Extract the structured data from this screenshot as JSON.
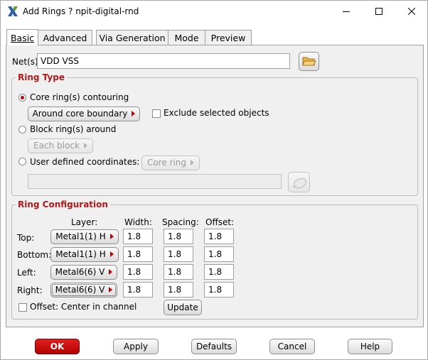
{
  "window": {
    "title": "Add Rings ? npit-digital-rnd",
    "minimize_icon": "minimize-icon",
    "maximize_icon": "maximize-icon",
    "close_icon": "close-icon"
  },
  "tabs": [
    {
      "label": "Basic",
      "active": true
    },
    {
      "label": "Advanced"
    },
    {
      "label": "Via Generation"
    },
    {
      "label": "Mode"
    },
    {
      "label": "Preview"
    }
  ],
  "nets": {
    "label": "Net(s):",
    "value": "VDD VSS",
    "browse_icon": "folder-open-icon"
  },
  "ring_type": {
    "title": "Ring Type",
    "core_ring_label": "Core ring(s) contouring",
    "core_ring_selected": true,
    "around_core_button": "Around core boundary",
    "exclude_label": "Exclude selected objects",
    "block_ring_label": "Block ring(s) around",
    "each_block_button": "Each block",
    "user_defined_label": "User defined coordinates:",
    "core_ring_button": "Core ring",
    "coords_value": "",
    "pick_icon": "mouse-pick-icon"
  },
  "ring_config": {
    "title": "Ring Configuration",
    "headers": {
      "layer": "Layer:",
      "width": "Width:",
      "spacing": "Spacing:",
      "offset": "Offset:"
    },
    "rows": [
      {
        "side": "Top:",
        "layer": "Metal1(1) H",
        "width": "1.8",
        "spacing": "1.8",
        "offset": "1.8"
      },
      {
        "side": "Bottom:",
        "layer": "Metal1(1) H",
        "width": "1.8",
        "spacing": "1.8",
        "offset": "1.8"
      },
      {
        "side": "Left:",
        "layer": "Metal6(6) V",
        "width": "1.8",
        "spacing": "1.8",
        "offset": "1.8"
      },
      {
        "side": "Right:",
        "layer": "Metal6(6) V",
        "width": "1.8",
        "spacing": "1.8",
        "offset": "1.8"
      }
    ],
    "offset_center_label": "Offset: Center in channel",
    "update_button": "Update"
  },
  "footer": {
    "ok": "OK",
    "apply": "Apply",
    "defaults": "Defaults",
    "cancel": "Cancel",
    "help": "Help"
  },
  "colors": {
    "accent_red": "#c00000",
    "group_title": "#b01a1a"
  }
}
